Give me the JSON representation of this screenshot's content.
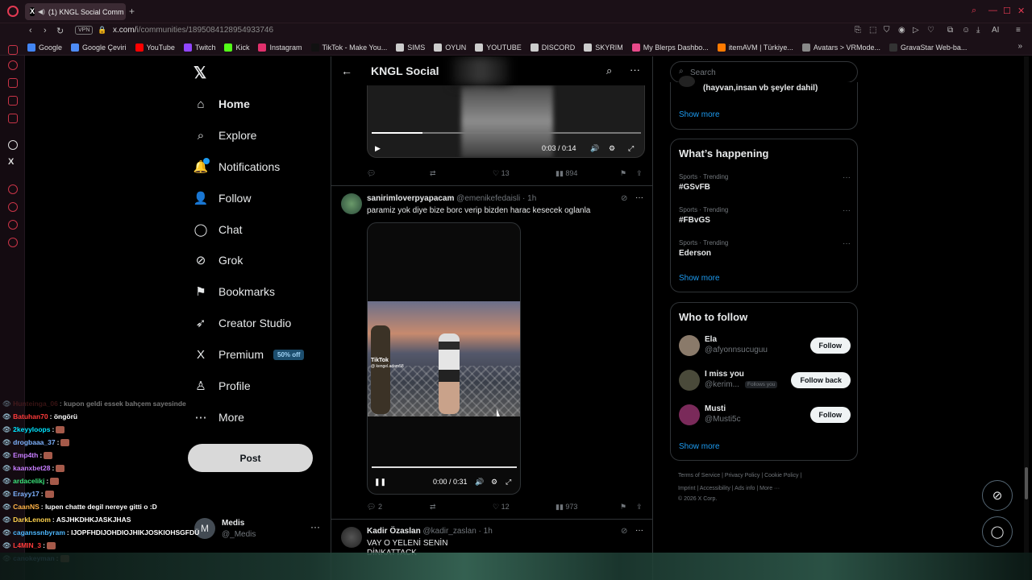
{
  "browser": {
    "tab_title": "(1) KNGL Social Comm",
    "url_host": "x.com/",
    "url_path": "i/communities/1895084128954933746",
    "vpn": "VPN",
    "bookmarks": [
      {
        "label": "Google",
        "color": "#4285f4"
      },
      {
        "label": "Google Çeviri",
        "color": "#4d8bf5"
      },
      {
        "label": "YouTube",
        "color": "#ff0000"
      },
      {
        "label": "Twitch",
        "color": "#9146ff"
      },
      {
        "label": "Kick",
        "color": "#53fc18"
      },
      {
        "label": "Instagram",
        "color": "#e1306c"
      },
      {
        "label": "TikTok - Make You...",
        "color": "#111111"
      },
      {
        "label": "SIMS",
        "color": "#cccccc"
      },
      {
        "label": "OYUN",
        "color": "#cccccc"
      },
      {
        "label": "YOUTUBE",
        "color": "#cccccc"
      },
      {
        "label": "DISCORD",
        "color": "#cccccc"
      },
      {
        "label": "SKYRIM",
        "color": "#cccccc"
      },
      {
        "label": "My Blerps Dashbo...",
        "color": "#e84a8a"
      },
      {
        "label": "itemAVM | Türkiye...",
        "color": "#ff7a00"
      },
      {
        "label": "Avatars > VRMode...",
        "color": "#888888"
      },
      {
        "label": "GravaStar Web-ba...",
        "color": "#333333"
      }
    ]
  },
  "nav": {
    "items": [
      {
        "label": "Home",
        "icon": "home-icon",
        "glyph": "⌂"
      },
      {
        "label": "Explore",
        "icon": "search-icon",
        "glyph": "⌕"
      },
      {
        "label": "Notifications",
        "icon": "bell-icon",
        "glyph": "🔔"
      },
      {
        "label": "Follow",
        "icon": "follow-icon",
        "glyph": "👤"
      },
      {
        "label": "Chat",
        "icon": "chat-icon",
        "glyph": "◯"
      },
      {
        "label": "Grok",
        "icon": "grok-icon",
        "glyph": "⊘"
      },
      {
        "label": "Bookmarks",
        "icon": "bookmark-icon",
        "glyph": "⚑"
      },
      {
        "label": "Creator Studio",
        "icon": "rocket-icon",
        "glyph": "➶"
      },
      {
        "label": "Premium",
        "icon": "x-icon",
        "glyph": "X"
      },
      {
        "label": "Profile",
        "icon": "profile-icon",
        "glyph": "♙"
      },
      {
        "label": "More",
        "icon": "more-icon",
        "glyph": "⋯"
      }
    ],
    "premium_badge": "50% off",
    "post_button": "Post",
    "account": {
      "initial": "M",
      "name": "Medis",
      "handle": "@_Medis"
    }
  },
  "chat": [
    {
      "user": "Hunteinga_06",
      "color": "#7a2a2a",
      "msg": ": kupon geldi essek bahçem sayesinde",
      "emote": false
    },
    {
      "user": "Batuhan70",
      "color": "#ff3b3b",
      "msg": ": öngörü",
      "emote": false
    },
    {
      "user": "2keyyloops",
      "color": "#00e5ff",
      "msg": ":",
      "emote": true
    },
    {
      "user": "drogbaaa_37",
      "color": "#7fb3ff",
      "msg": ":",
      "emote": true
    },
    {
      "user": "Emp4th",
      "color": "#c77dff",
      "msg": ":",
      "emote": true
    },
    {
      "user": "kaanxbet28",
      "color": "#c77dff",
      "msg": ":",
      "emote": true
    },
    {
      "user": "ardacelikj",
      "color": "#3be37a",
      "msg": ":",
      "emote": true
    },
    {
      "user": "Erayy17",
      "color": "#7fb3ff",
      "msg": ":",
      "emote": true
    },
    {
      "user": "CaanNS",
      "color": "#ffb347",
      "msg": ": lupen chatte degil nereye gitti o :D",
      "emote": false
    },
    {
      "user": "DarkLenom",
      "color": "#ffd34d",
      "msg": ": ASJHKDHKJASKJHAS",
      "emote": false
    },
    {
      "user": "caganssnbyram",
      "color": "#4db8ff",
      "msg": ": IJOPFHDIJOHDIOJHIKJOSKIOHSGFDÜ",
      "emote": false
    },
    {
      "user": "L4MIN_3",
      "color": "#ff3b3b",
      "msg": ":",
      "emote": true
    },
    {
      "user": "canokeyman",
      "color": "#7fb3ff",
      "msg": ":",
      "emote": true
    }
  ],
  "feed": {
    "title": "KNGL Social",
    "video1": {
      "time": "0:03 / 0:14",
      "progress": 0.19
    },
    "tweet0_actions": {
      "replies": "",
      "retweets": "",
      "likes": "13",
      "views": "894"
    },
    "tweet1": {
      "name": "sanirimloverpyapacam",
      "handle": "@emenikefedaisli · 1h",
      "text": "paramiz yok diye bize borc verip bizden harac kesecek oglanla",
      "video_time": "0:00 / 0:31",
      "watermark": "TikTok",
      "watermark_sub": "@ kengel.adam58",
      "actions": {
        "replies": "2",
        "retweets": "",
        "likes": "12",
        "views": "973"
      }
    },
    "tweet2": {
      "name": "Kadir Özaslan",
      "handle": "@kadir_zaslan · 1h",
      "text": "VAY O YELENİ SENİN",
      "text2": "DİNKATTACK"
    }
  },
  "right": {
    "search_placeholder": "Search",
    "community_rule": "(hayvan,insan vb şeyler dahil)",
    "show_more": "Show more",
    "whats_happening": "What’s happening",
    "trends": [
      {
        "category": "Sports · Trending",
        "tag": "#GSvFB"
      },
      {
        "category": "Sports · Trending",
        "tag": "#FBvGS"
      },
      {
        "category": "Sports · Trending",
        "tag": "Ederson"
      }
    ],
    "who_to_follow": "Who to follow",
    "follow_suggestions": [
      {
        "name": "Ela",
        "handle": "@afyonnsucuguu",
        "button": "Follow",
        "follows_you": "",
        "color": "#8a7a6a"
      },
      {
        "name": "I miss you",
        "handle": "@kerim...",
        "button": "Follow back",
        "follows_you": "Follows you",
        "color": "#4a4a3a"
      },
      {
        "name": "Musti",
        "handle": "@Musti5c",
        "button": "Follow",
        "follows_you": "",
        "color": "#7a2a5a"
      }
    ],
    "footer_line1": "Terms of Service  |  Privacy Policy  |  Cookie Policy  |",
    "footer_line2": "Imprint  |  Accessibility  |  Ads info  |  More ···",
    "footer_line3": "© 2026 X Corp."
  }
}
